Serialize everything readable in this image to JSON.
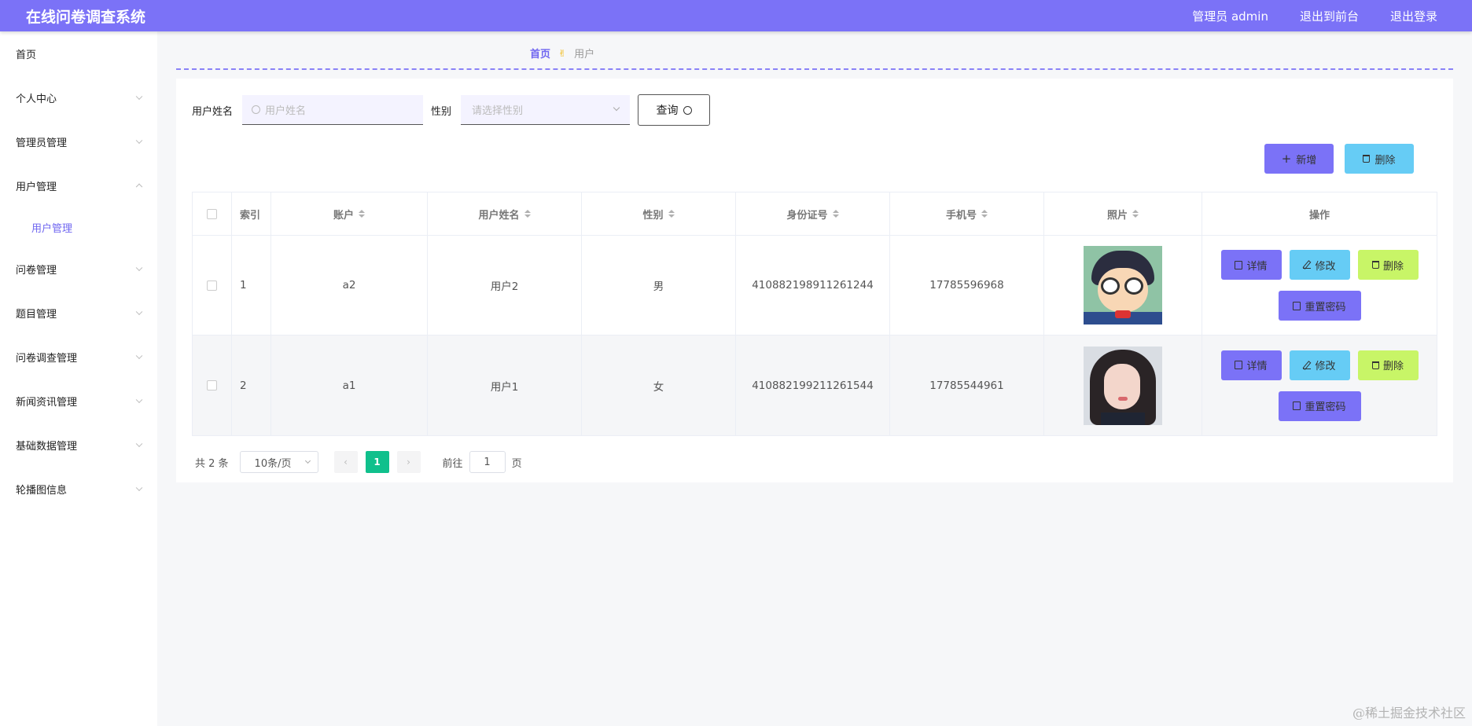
{
  "header": {
    "title": "在线问卷调查系统",
    "admin_label": "管理员 admin",
    "frontend_label": "退出到前台",
    "logout_label": "退出登录",
    "accent_color": "#7b72f7"
  },
  "sidebar": {
    "items": [
      {
        "label": "首页"
      },
      {
        "label": "个人中心"
      },
      {
        "label": "管理员管理"
      },
      {
        "label": "用户管理"
      },
      {
        "label": "问卷管理"
      },
      {
        "label": "题目管理"
      },
      {
        "label": "问卷调查管理"
      },
      {
        "label": "新闻资讯管理"
      },
      {
        "label": "基础数据管理"
      },
      {
        "label": "轮播图信息"
      }
    ],
    "active_sub": "用户管理"
  },
  "breadcrumb": {
    "home": "首页",
    "separator_icon": "✌",
    "current": "用户"
  },
  "search": {
    "name_label": "用户姓名",
    "name_placeholder": "用户姓名",
    "gender_label": "性别",
    "gender_placeholder": "请选择性别",
    "query_label": "查询"
  },
  "actions": {
    "add_label": "新增",
    "delete_label": "删除"
  },
  "table": {
    "headers": {
      "index": "索引",
      "account": "账户",
      "name": "用户姓名",
      "gender": "性别",
      "id_card": "身份证号",
      "phone": "手机号",
      "photo": "照片",
      "ops": "操作"
    },
    "rows": [
      {
        "index": "1",
        "account": "a2",
        "name": "用户2",
        "gender": "男",
        "id_card": "410882198911261244",
        "phone": "17785596968",
        "photo_icon": "avatar-conan"
      },
      {
        "index": "2",
        "account": "a1",
        "name": "用户1",
        "gender": "女",
        "id_card": "410882199211261544",
        "phone": "17785544961",
        "photo_icon": "avatar-girl"
      }
    ],
    "op_labels": {
      "detail": "详情",
      "edit": "修改",
      "delete": "删除",
      "reset": "重置密码"
    }
  },
  "pagination": {
    "total": "共 2 条",
    "page_size": "10条/页",
    "current_page": "1",
    "goto_prefix": "前往",
    "goto_value": "1",
    "goto_suffix": "页"
  },
  "watermark": "@稀土掘金技术社区"
}
